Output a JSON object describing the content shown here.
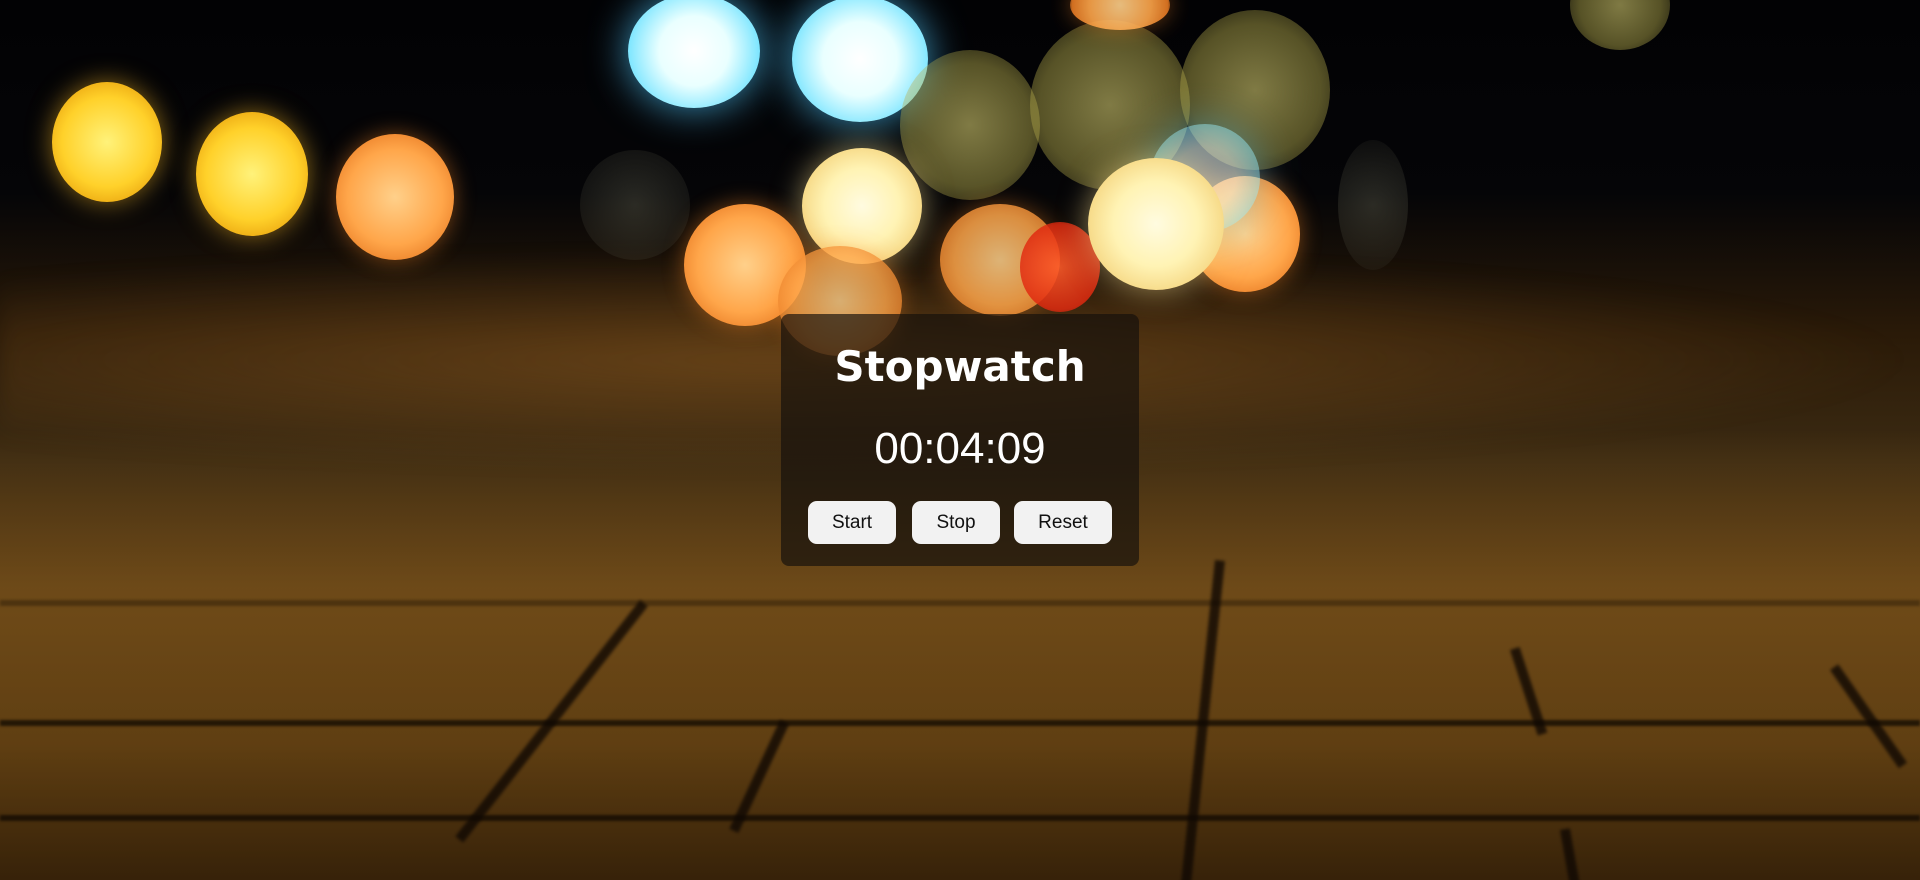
{
  "stopwatch": {
    "title": "Stopwatch",
    "time": "00:04:09",
    "buttons": {
      "start": "Start",
      "stop": "Stop",
      "reset": "Reset"
    }
  },
  "background": {
    "description_colors": {
      "sky": "#050507",
      "pavement": "#8a5c1c",
      "card": "#14100c"
    }
  }
}
